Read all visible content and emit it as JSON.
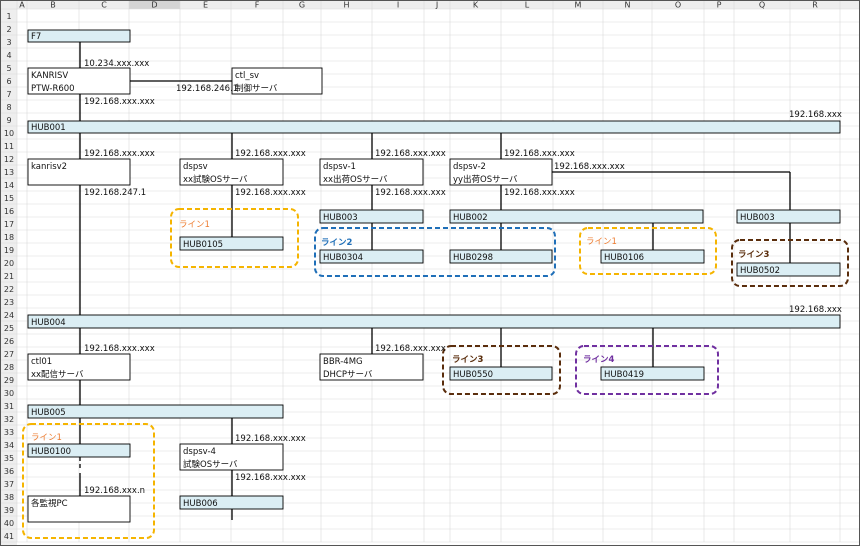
{
  "sheet": {
    "columns": [
      "A",
      "B",
      "C",
      "D",
      "E",
      "F",
      "G",
      "H",
      "I",
      "J",
      "K",
      "L",
      "M",
      "N",
      "O",
      "P",
      "Q",
      "R"
    ],
    "rows": [
      "1",
      "2",
      "3",
      "4",
      "5",
      "6",
      "7",
      "8",
      "9",
      "10",
      "11",
      "12",
      "13",
      "14",
      "15",
      "16",
      "17",
      "18",
      "19",
      "20",
      "21",
      "22",
      "23",
      "24",
      "25",
      "26",
      "27",
      "28",
      "29",
      "30",
      "31",
      "32",
      "33",
      "34",
      "35",
      "36",
      "37",
      "38",
      "39",
      "40",
      "41"
    ],
    "selected_column": "D"
  },
  "colors": {
    "hub_fill": "#dbeef4",
    "line_orange": "#f5b400",
    "line_blue": "#1f6fb8",
    "line_brown": "#5a2d0c",
    "line_purple": "#7030a0",
    "label_orange": "#ed7d31"
  },
  "nodes": {
    "f7": "F7",
    "kanrisv_1": "KANRISV",
    "kanrisv_2": "PTW-R600",
    "ctl_sv_1": "ctl_sv",
    "ctl_sv_2": "制御サーバ",
    "kanrisv2": "kanrisv2",
    "dspsv_1": "dspsv",
    "dspsv_2": "xx試験OSサーバ",
    "dspsv1_1": "dspsv-1",
    "dspsv1_2": "xx出荷OSサーバ",
    "dspsv2_1": "dspsv-2",
    "dspsv2_2": "yy出荷OSサーバ",
    "ctl01_1": "ctl01",
    "ctl01_2": "xx配信サーバ",
    "bbr_1": "BBR-4MG",
    "bbr_2": "DHCPサーバ",
    "dspsv4_1": "dspsv-4",
    "dspsv4_2": "試験OSサーバ",
    "monitor_pc": "各監視PC"
  },
  "hubs": {
    "hub001": "HUB001",
    "hub003a": "HUB003",
    "hub002": "HUB002",
    "hub003b": "HUB003",
    "hub0105": "HUB0105",
    "hub0304": "HUB0304",
    "hub0298": "HUB0298",
    "hub0106": "HUB0106",
    "hub0502": "HUB0502",
    "hub004": "HUB004",
    "hub0550": "HUB0550",
    "hub0419": "HUB0419",
    "hub005": "HUB005",
    "hub0100": "HUB0100",
    "hub006": "HUB006"
  },
  "ips": {
    "f7_below": "10.234.xxx.xxx",
    "ctl_link": "192.168.246.1",
    "kanrisv_below": "192.168.xxx.xxx",
    "hub001_right": "192.168.xxx",
    "kanrisv2_top": "192.168.xxx.xxx",
    "dspsv_top": "192.168.xxx.xxx",
    "dspsv1_top": "192.168.xxx.xxx",
    "dspsv2_top": "192.168.xxx.xxx",
    "dspsv2_right": "192.168.xxx.xxx",
    "kanrisv2_below": "192.168.247.1",
    "dspsv_below": "192.168.xxx.xxx",
    "dspsv1_below": "192.168.xxx.xxx",
    "dspsv2_below": "192.168.xxx.xxx",
    "hub004_right": "192.168.xxx",
    "ctl01_top": "192.168.xxx.xxx",
    "bbr_top": "192.168.xxx.xxx",
    "dspsv4_top": "192.168.xxx.xxx",
    "dspsv4_below": "192.168.xxx.xxx",
    "monitor_top": "192.168.xxx.n"
  },
  "lines": {
    "line1_a": "ライン1",
    "line2": "ライン2",
    "line1_b": "ライン1",
    "line3_a": "ライン3",
    "line3_b": "ライン3",
    "line4": "ライン4",
    "line1_c": "ライン1"
  }
}
